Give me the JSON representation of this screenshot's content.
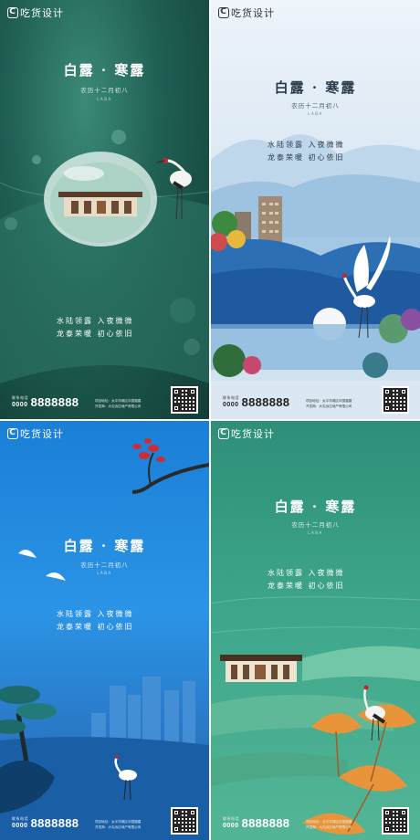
{
  "logo_text": "吃货设计",
  "posters": [
    {
      "title": "白露 · 寒露",
      "subtitle": "农历十二月初八",
      "latin": "LABA",
      "poem_line1": "水陆领露  入夜微微",
      "poem_line2": "龙泰荣暖  初心依旧",
      "hotline_label": "联系电话",
      "phone_prefix": "0000",
      "phone": "8888888",
      "info_line1": "项目地址：太平洋城区中国福建",
      "info_line2": "开发商：大屯远达地产有限公司"
    },
    {
      "title": "白露 · 寒露",
      "subtitle": "农历十二月初八",
      "latin": "LABA",
      "poem_line1": "水陆领露  入夜微微",
      "poem_line2": "龙泰荣暖  初心依旧",
      "hotline_label": "联系电话",
      "phone_prefix": "0000",
      "phone": "8888888",
      "info_line1": "项目地址：太平洋城区中国福建",
      "info_line2": "开发商：大屯远达地产有限公司"
    },
    {
      "title": "白露 · 寒露",
      "subtitle": "农历十二月初八",
      "latin": "LABA",
      "poem_line1": "水陆领露  入夜微微",
      "poem_line2": "龙泰荣暖  初心依旧",
      "hotline_label": "联系电话",
      "phone_prefix": "0000",
      "phone": "8888888",
      "info_line1": "项目地址：太平洋城区中国福建",
      "info_line2": "开发商：大屯远达地产有限公司"
    },
    {
      "title": "白露 · 寒露",
      "subtitle": "农历十二月初八",
      "latin": "LABA",
      "poem_line1": "水陆领露  入夜微微",
      "poem_line2": "龙泰荣暖  初心依旧",
      "hotline_label": "联系电话",
      "phone_prefix": "0000",
      "phone": "8888888",
      "info_line1": "项目地址：太平洋城区中国福建",
      "info_line2": "开发商：大屯远达地产有限公司"
    }
  ],
  "colors": {
    "green_dark": "#1f5e52",
    "sky_light": "#dbe8f4",
    "blue": "#2b94e6",
    "teal": "#3fa88c",
    "text_dark": "#2a3a4a",
    "ginkgo": "#e8943a"
  }
}
